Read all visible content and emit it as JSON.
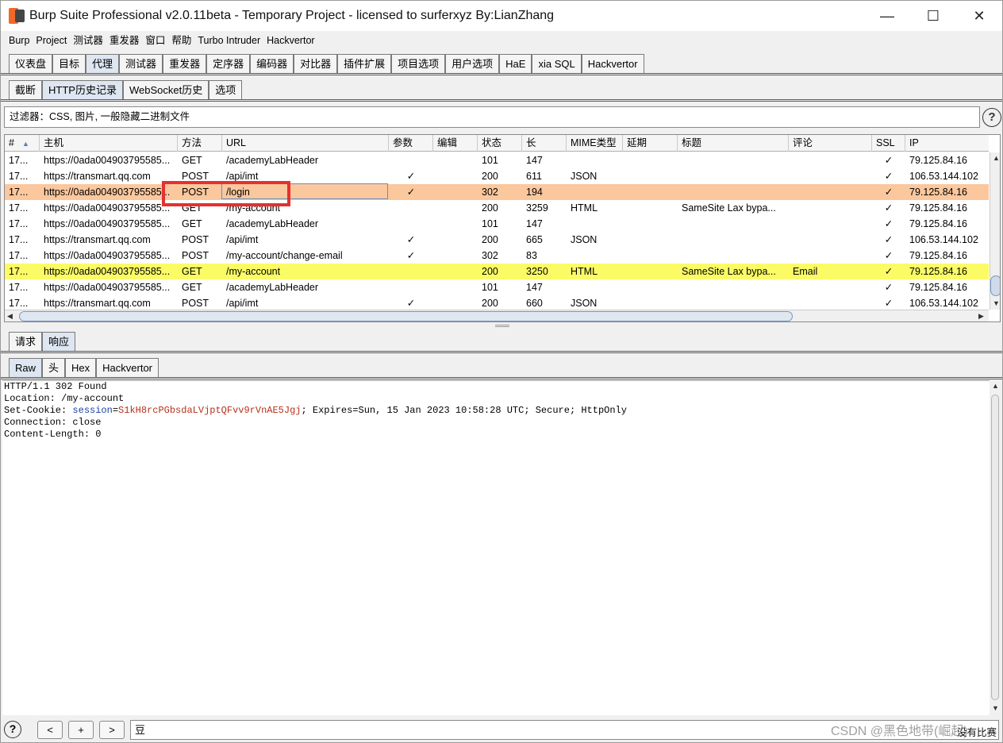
{
  "window": {
    "title": "Burp Suite Professional v2.0.11beta - Temporary Project - licensed to surferxyz By:LianZhang",
    "controls": [
      "—",
      "☐",
      "✕"
    ]
  },
  "menu": [
    "Burp",
    "Project",
    "测试器",
    "重发器",
    "窗口",
    "帮助",
    "Turbo Intruder",
    "Hackvertor"
  ],
  "main_tabs": [
    "仪表盘",
    "目标",
    "代理",
    "测试器",
    "重发器",
    "定序器",
    "编码器",
    "对比器",
    "插件扩展",
    "项目选项",
    "用户选项",
    "HaE",
    "xia SQL",
    "Hackvertor"
  ],
  "main_tabs_selected": 2,
  "proxy_tabs": [
    "截断",
    "HTTP历史记录",
    "WebSocket历史",
    "选项"
  ],
  "proxy_tabs_selected": 1,
  "filter_text": "过滤器：CSS, 图片, 一般隐藏二进制文件",
  "help_label": "?",
  "table": {
    "columns": [
      "#",
      "主机",
      "方法",
      "URL",
      "参数",
      "编辑",
      "状态",
      "长",
      "MIME类型",
      "延期",
      "标题",
      "评论",
      "SSL",
      "IP"
    ],
    "sort_arrow": "▲",
    "rows": [
      {
        "num": "17...",
        "host": "https://0ada004903795585...",
        "method": "GET",
        "url": "/academyLabHeader",
        "params": "",
        "status": "101",
        "length": "147",
        "mime": "",
        "title": "",
        "comment": "",
        "ssl": "✓",
        "ip": "79.125.84.16",
        "hl": ""
      },
      {
        "num": "17...",
        "host": "https://transmart.qq.com",
        "method": "POST",
        "url": "/api/imt",
        "params": "✓",
        "status": "200",
        "length": "611",
        "mime": "JSON",
        "title": "",
        "comment": "",
        "ssl": "✓",
        "ip": "106.53.144.102",
        "hl": ""
      },
      {
        "num": "17...",
        "host": "https://0ada004903795585...",
        "method": "POST",
        "url": "/login",
        "params": "✓",
        "status": "302",
        "length": "194",
        "mime": "",
        "title": "",
        "comment": "",
        "ssl": "✓",
        "ip": "79.125.84.16",
        "hl": "orange"
      },
      {
        "num": "17...",
        "host": "https://0ada004903795585...",
        "method": "GET",
        "url": "/my-account",
        "params": "",
        "status": "200",
        "length": "3259",
        "mime": "HTML",
        "title": "SameSite Lax bypa...",
        "comment": "",
        "ssl": "✓",
        "ip": "79.125.84.16",
        "hl": ""
      },
      {
        "num": "17...",
        "host": "https://0ada004903795585...",
        "method": "GET",
        "url": "/academyLabHeader",
        "params": "",
        "status": "101",
        "length": "147",
        "mime": "",
        "title": "",
        "comment": "",
        "ssl": "✓",
        "ip": "79.125.84.16",
        "hl": ""
      },
      {
        "num": "17...",
        "host": "https://transmart.qq.com",
        "method": "POST",
        "url": "/api/imt",
        "params": "✓",
        "status": "200",
        "length": "665",
        "mime": "JSON",
        "title": "",
        "comment": "",
        "ssl": "✓",
        "ip": "106.53.144.102",
        "hl": ""
      },
      {
        "num": "17...",
        "host": "https://0ada004903795585...",
        "method": "POST",
        "url": "/my-account/change-email",
        "params": "✓",
        "status": "302",
        "length": "83",
        "mime": "",
        "title": "",
        "comment": "",
        "ssl": "✓",
        "ip": "79.125.84.16",
        "hl": ""
      },
      {
        "num": "17...",
        "host": "https://0ada004903795585...",
        "method": "GET",
        "url": "/my-account",
        "params": "",
        "status": "200",
        "length": "3250",
        "mime": "HTML",
        "title": "SameSite Lax bypa...",
        "comment": "Email",
        "ssl": "✓",
        "ip": "79.125.84.16",
        "hl": "yellow"
      },
      {
        "num": "17...",
        "host": "https://0ada004903795585...",
        "method": "GET",
        "url": "/academyLabHeader",
        "params": "",
        "status": "101",
        "length": "147",
        "mime": "",
        "title": "",
        "comment": "",
        "ssl": "✓",
        "ip": "79.125.84.16",
        "hl": ""
      },
      {
        "num": "17...",
        "host": "https://transmart.qq.com",
        "method": "POST",
        "url": "/api/imt",
        "params": "✓",
        "status": "200",
        "length": "660",
        "mime": "JSON",
        "title": "",
        "comment": "",
        "ssl": "✓",
        "ip": "106.53.144.102",
        "hl": ""
      }
    ]
  },
  "req_resp_tabs": [
    "请求",
    "响应"
  ],
  "req_resp_selected": 1,
  "view_tabs": [
    "Raw",
    "头",
    "Hex",
    "Hackvertor"
  ],
  "view_selected": 0,
  "response_lines": [
    {
      "text": "HTTP/1.1 302 Found"
    },
    {
      "text": "Location: /my-account"
    },
    {
      "pre": "Set-Cookie: ",
      "key": "session",
      "eq": "=",
      "val": "S1kH8rcPGbsdaLVjptQFvv9rVnAE5Jgj",
      "post": "; Expires=Sun, 15 Jan 2023 10:58:28 UTC; Secure; HttpOnly"
    },
    {
      "text": "Connection: close"
    },
    {
      "text": "Content-Length: 0"
    }
  ],
  "search": {
    "help": "?",
    "prev": "<",
    "add": "+",
    "next": ">",
    "value": "豆",
    "status": "没有比赛"
  },
  "watermark": "CSDN @黑色地带(崛起)",
  "colors": {
    "orange_row": "#fbc79d",
    "yellow_row": "#fbfb66",
    "annotation_box": "#e5312f"
  }
}
